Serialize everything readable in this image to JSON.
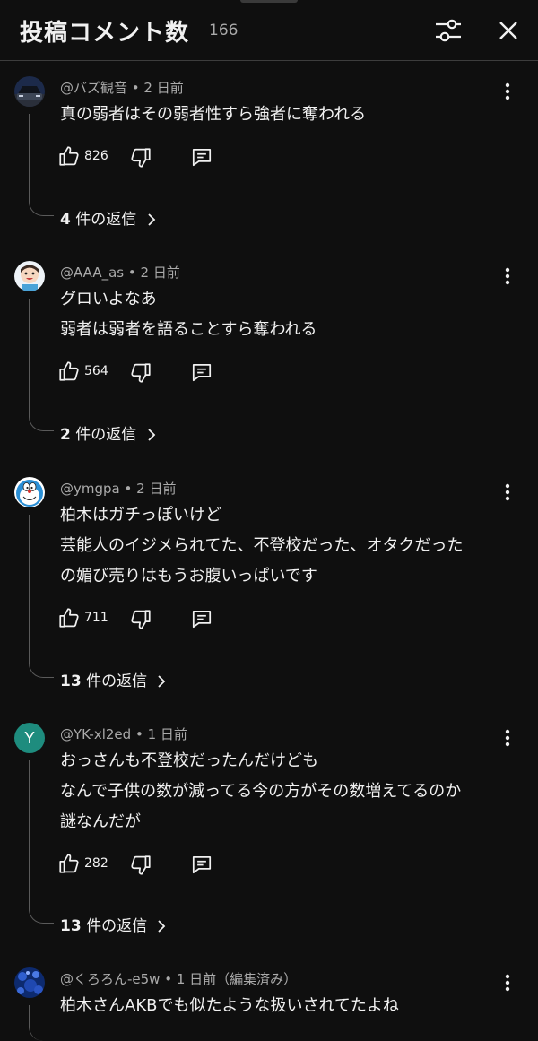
{
  "header": {
    "title": "投稿コメント数",
    "count": "166"
  },
  "comments": [
    {
      "author": "@バズ観音",
      "time": "2 日前",
      "lines": [
        "真の弱者はその弱者性すら強者に奪われる"
      ],
      "likes": "826",
      "reply_count": "4",
      "reply_suffix": "件の返信"
    },
    {
      "author": "@AAA_as",
      "time": "2 日前",
      "lines": [
        "グロいよなあ",
        "弱者は弱者を語ることすら奪われる"
      ],
      "likes": "564",
      "reply_count": "2",
      "reply_suffix": "件の返信"
    },
    {
      "author": "@ymgpa",
      "time": "2 日前",
      "lines": [
        "柏木はガチっぽいけど",
        "芸能人のイジメられてた、不登校だった、オタクだった",
        "の媚び売りはもうお腹いっぱいです"
      ],
      "likes": "711",
      "reply_count": "13",
      "reply_suffix": "件の返信"
    },
    {
      "author": "@YK-xl2ed",
      "time": "1 日前",
      "avatar_letter": "Y",
      "lines": [
        "おっさんも不登校だったんだけども",
        "なんで子供の数が減ってる今の方がその数増えてるのか",
        "謎なんだが"
      ],
      "likes": "282",
      "reply_count": "13",
      "reply_suffix": "件の返信"
    },
    {
      "author": "@くろろん-e5w",
      "time": "1 日前（編集済み）",
      "lines": [
        "柏木さんAKBでも似たような扱いされてたよね"
      ]
    }
  ],
  "colors": {
    "background": "#0f0f0f",
    "text": "#f1f1f1",
    "secondary": "#aaaaaa",
    "avatar_y": "#1e8c7e"
  },
  "icons": [
    "filter-icon",
    "close-icon",
    "more-vert-icon",
    "thumb-up-icon",
    "thumb-down-icon",
    "reply-icon",
    "chevron-right-icon"
  ]
}
